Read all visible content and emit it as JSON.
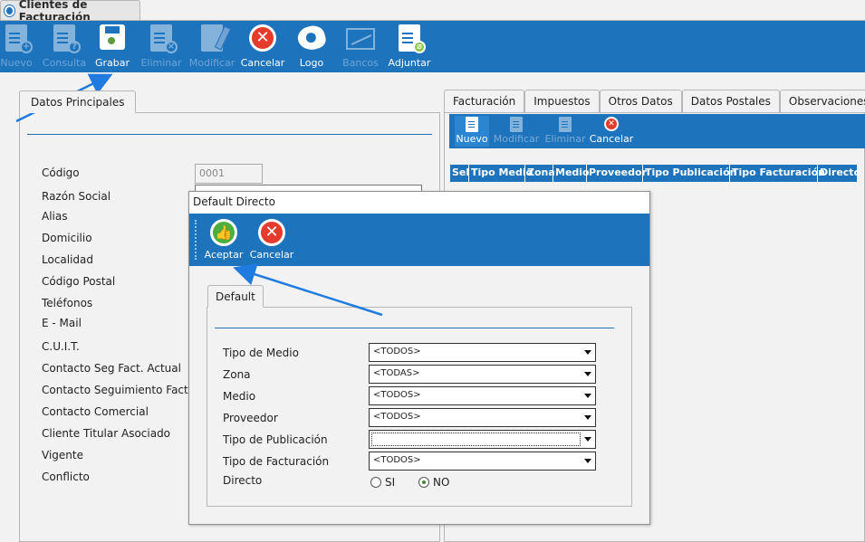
{
  "window_tab": {
    "title": "Clientes de Facturación"
  },
  "toolbar": {
    "buttons": [
      {
        "label": "Nuevo",
        "icon": "new-doc-icon",
        "enabled": false
      },
      {
        "label": "Consulta",
        "icon": "query-doc-icon",
        "enabled": false
      },
      {
        "label": "Grabar",
        "icon": "save-icon",
        "enabled": true
      },
      {
        "label": "Eliminar",
        "icon": "delete-doc-icon",
        "enabled": false
      },
      {
        "label": "Modificar",
        "icon": "edit-pencil-icon",
        "enabled": false
      },
      {
        "label": "Cancelar",
        "icon": "cancel-icon",
        "enabled": true
      },
      {
        "label": "Logo",
        "icon": "logo-icon",
        "enabled": true
      },
      {
        "label": "Bancos",
        "icon": "chart-icon",
        "enabled": false
      },
      {
        "label": "Adjuntar",
        "icon": "attach-icon",
        "enabled": true
      }
    ]
  },
  "left_panel": {
    "tab": "Datos Principales",
    "fields": [
      {
        "label": "Código",
        "value": "0001"
      },
      {
        "label": "Razón Social"
      },
      {
        "label": "Alias"
      },
      {
        "label": "Domicilio"
      },
      {
        "label": "Localidad"
      },
      {
        "label": "Código Postal"
      },
      {
        "label": "Teléfonos"
      },
      {
        "label": "E - Mail"
      },
      {
        "label": "C.U.I.T."
      },
      {
        "label": "Contacto Seg Fact. Actual"
      },
      {
        "label": "Contacto Seguimiento Fact."
      },
      {
        "label": "Contacto Comercial"
      },
      {
        "label": "Cliente Titular Asociado"
      },
      {
        "label": "Vigente"
      },
      {
        "label": "Conflicto"
      }
    ]
  },
  "right_panel": {
    "tabs": [
      "Facturación",
      "Impuestos",
      "Otros Datos",
      "Datos Postales",
      "Observaciones"
    ],
    "toolbar": [
      {
        "label": "Nuevo",
        "enabled": true
      },
      {
        "label": "Modificar",
        "enabled": false
      },
      {
        "label": "Eliminar",
        "enabled": false
      },
      {
        "label": "Cancelar",
        "enabled": true
      }
    ],
    "grid_columns": [
      "Sel",
      "Tipo Medio",
      "Zona",
      "Medio",
      "Proveedor",
      "Tipo Publicación",
      "Tipo Facturación",
      "Directo"
    ]
  },
  "dialog": {
    "title": "Default Directo",
    "buttons": {
      "accept": "Aceptar",
      "cancel": "Cancelar"
    },
    "tab": "Default",
    "fields": [
      {
        "label": "Tipo de Medio",
        "value": "<TODOS>"
      },
      {
        "label": "Zona",
        "value": "<TODAS>"
      },
      {
        "label": "Medio",
        "value": "<TODOS>"
      },
      {
        "label": "Proveedor",
        "value": "<TODOS>"
      },
      {
        "label": "Tipo de Publicación",
        "value": ""
      },
      {
        "label": "Tipo de Facturación",
        "value": "<TODOS>"
      }
    ],
    "directo": {
      "label": "Directo",
      "option_si": "SI",
      "option_no": "NO",
      "selected": "NO"
    }
  },
  "colors": {
    "toolbar_blue": "#1d74bd",
    "cancel_red": "#e53b2d",
    "accept_green": "#4cae3c"
  }
}
